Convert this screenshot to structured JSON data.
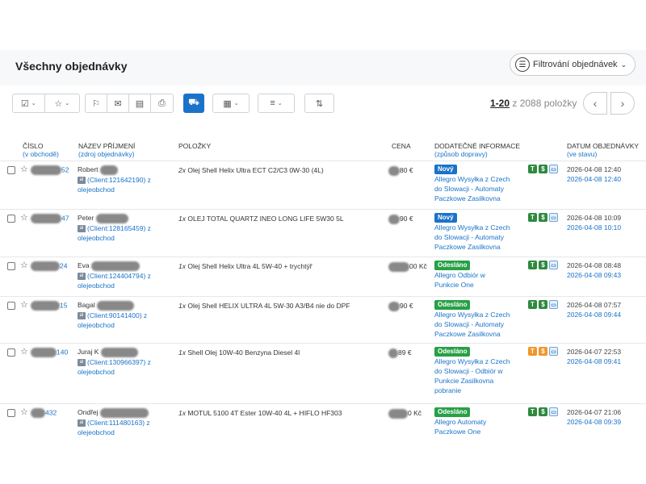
{
  "header": {
    "title": "Všechny objednávky",
    "filter_label": "Filtrování objednávek"
  },
  "toolbar": {
    "pagination_range": "1-20",
    "pagination_rest": " z 2088 položky",
    "prev": "‹",
    "next": "›"
  },
  "columns": {
    "number": "ČÍSLO",
    "number_sub": "(v obchodě)",
    "name": "NÁZEV PŘÍJMENÍ",
    "name_sub": "(zdroj objednávky)",
    "items": "POLOŽKY",
    "price": "CENA",
    "info": "DODATEČNÉ INFORMACE",
    "info_sub": "(způsob dopravy)",
    "date": "DATUM OBJEDNÁVKY",
    "date_sub": "(ve stavu)"
  },
  "orders": [
    {
      "num_suffix": "52",
      "name": "Robert",
      "client": "(Client:121642190) z",
      "source": "olejeobchod",
      "qty": "2x",
      "item": "Olej Shell Helix Ultra ECT C2/C3 0W-30 (4L)",
      "price_suffix": "80 €",
      "status": "Nový",
      "shipping": [
        "Allegro Wysyłka z Czech",
        "do Slowacji - Automaty",
        "Paczkowe Zasilkovna"
      ],
      "date1": "2026-04-08 12:40",
      "date2": "2026-04-08 12:40"
    },
    {
      "num_suffix": "47",
      "name": "Peter",
      "client": "(Client:128165459) z",
      "source": "olejeobchod",
      "qty": "1x",
      "item": "OLEJ TOTAL QUARTZ INEO LONG LIFE 5W30 5L",
      "price_suffix": "90 €",
      "status": "Nový",
      "shipping": [
        "Allegro Wysyłka z Czech",
        "do Slowacji - Automaty",
        "Paczkowe Zasilkovna"
      ],
      "date1": "2026-04-08 10:09",
      "date2": "2026-04-08 10:10"
    },
    {
      "num_suffix": "24",
      "name": "Eva",
      "client": "(Client:124404794) z",
      "source": "olejeobchod",
      "qty": "1x",
      "item": "Olej Shell Helix Ultra 4L 5W-40 + trychtýř",
      "price_suffix": "00 Kč",
      "status": "Odesláno",
      "shipping": [
        "Allegro Odbiór w",
        "Punkcie One"
      ],
      "date1": "2026-04-08 08:48",
      "date2": "2026-04-08 09:43"
    },
    {
      "num_suffix": "15",
      "name": "Bagal",
      "client": "(Client:90141400) z",
      "source": "olejeobchod",
      "qty": "1x",
      "item": "Olej Shell HELIX ULTRA 4L 5W-30 A3/B4 nie do DPF",
      "price_suffix": "90 €",
      "status": "Odesláno",
      "shipping": [
        "Allegro Wysyłka z Czech",
        "do Slowacji - Automaty",
        "Paczkowe Zasilkovna"
      ],
      "date1": "2026-04-08 07:57",
      "date2": "2026-04-08 09:44"
    },
    {
      "num_suffix": "140",
      "name": "Juraj K",
      "client": "(Client:130966397) z",
      "source": "olejeobchod",
      "qty": "1x",
      "item": "Shell Olej 10W-40 Benzyna Diesel 4l",
      "price_suffix": "89 €",
      "status": "Odesláno",
      "shipping": [
        "Allegro Wysyłka z Czech",
        "do Slowacji - Odbiór w",
        "Punkcie Zasilkovna",
        "pobranie"
      ],
      "date1": "2026-04-07 22:53",
      "date2": "2026-04-08 09:41"
    },
    {
      "num_suffix": "432",
      "name": "Ondřej",
      "client": "(Client:111480163) z",
      "source": "olejeobchod",
      "qty": "1x",
      "item": "MOTUL 5100 4T Ester 10W-40 4L + HIFLO HF303",
      "price_suffix": "0 Kč",
      "status": "Odesláno",
      "shipping": [
        "Allegro Automaty",
        "Paczkowe One"
      ],
      "date1": "2026-04-07 21:06",
      "date2": "2026-04-08 09:39"
    }
  ]
}
